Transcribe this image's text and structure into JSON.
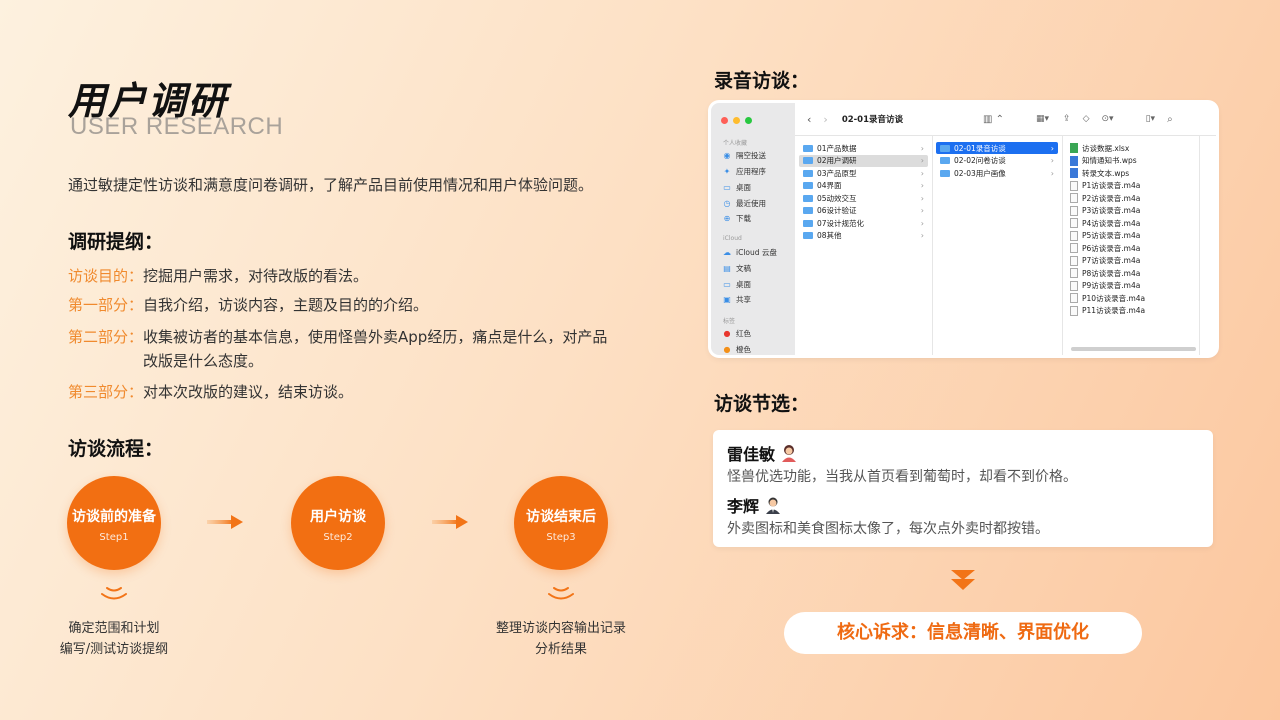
{
  "header": {
    "title_cn": "用户调研",
    "title_en": "USER RESEARCH"
  },
  "intro": "通过敏捷定性访谈和满意度问卷调研，了解产品目前使用情况和用户体验问题。",
  "outline": {
    "heading": "调研提纲：",
    "items": [
      {
        "label": "访谈目的：",
        "text": "挖掘用户需求，对待改版的看法。"
      },
      {
        "label": "第一部分：",
        "text": "自我介绍，访谈内容，主题及目的的介绍。"
      },
      {
        "label": "第二部分：",
        "text": "收集被访者的基本信息，使用怪兽外卖App经历，痛点是什么，对产品改版是什么态度。"
      },
      {
        "label": "第三部分：",
        "text": "对本次改版的建议，结束访谈。"
      }
    ]
  },
  "process": {
    "heading": "访谈流程：",
    "steps": [
      {
        "name": "访谈前的准备",
        "step": "Step1"
      },
      {
        "name": "用户访谈",
        "step": "Step2"
      },
      {
        "name": "访谈结束后",
        "step": "Step3"
      }
    ],
    "notes": [
      {
        "line1": "确定范围和计划",
        "line2": "编写/测试访谈提纲"
      },
      {
        "line1": "整理访谈内容输出记录",
        "line2": "分析结果"
      }
    ]
  },
  "recording": {
    "heading": "录音访谈：",
    "finder": {
      "path": "02-01录音访谈",
      "sidebar": {
        "fav_label": "个人收藏",
        "favorites": [
          "隔空投送",
          "应用程序",
          "桌面",
          "最近使用",
          "下载"
        ],
        "icloud_label": "iCloud",
        "icloud": [
          "iCloud 云盘",
          "文稿",
          "桌面",
          "共享"
        ],
        "tags_label": "标签",
        "tags": [
          {
            "name": "红色",
            "color": "#e8372e"
          },
          {
            "name": "橙色",
            "color": "#f39019"
          }
        ]
      },
      "col1": [
        "01产品数据",
        "02用户调研",
        "03产品原型",
        "04界面",
        "05动效交互",
        "06设计验证",
        "07设计规范化",
        "08其他"
      ],
      "col2": [
        "02-01录音访谈",
        "02-02问卷访谈",
        "02-03用户画像"
      ],
      "col3": [
        "访谈数据.xlsx",
        "知情通知书.wps",
        "转录文本.wps",
        "P1访谈录音.m4a",
        "P2访谈录音.m4a",
        "P3访谈录音.m4a",
        "P4访谈录音.m4a",
        "P5访谈录音.m4a",
        "P6访谈录音.m4a",
        "P7访谈录音.m4a",
        "P8访谈录音.m4a",
        "P9访谈录音.m4a",
        "P10访谈录音.m4a",
        "P11访谈录音.m4a"
      ]
    }
  },
  "quotes": {
    "heading": "访谈节选：",
    "items": [
      {
        "name": "雷佳敏",
        "text": "怪兽优选功能，当我从首页看到葡萄时，却看不到价格。"
      },
      {
        "name": "李辉",
        "text": "外卖图标和美食图标太像了，每次点外卖时都按错。"
      }
    ]
  },
  "core": "核心诉求：信息清晰、界面优化"
}
